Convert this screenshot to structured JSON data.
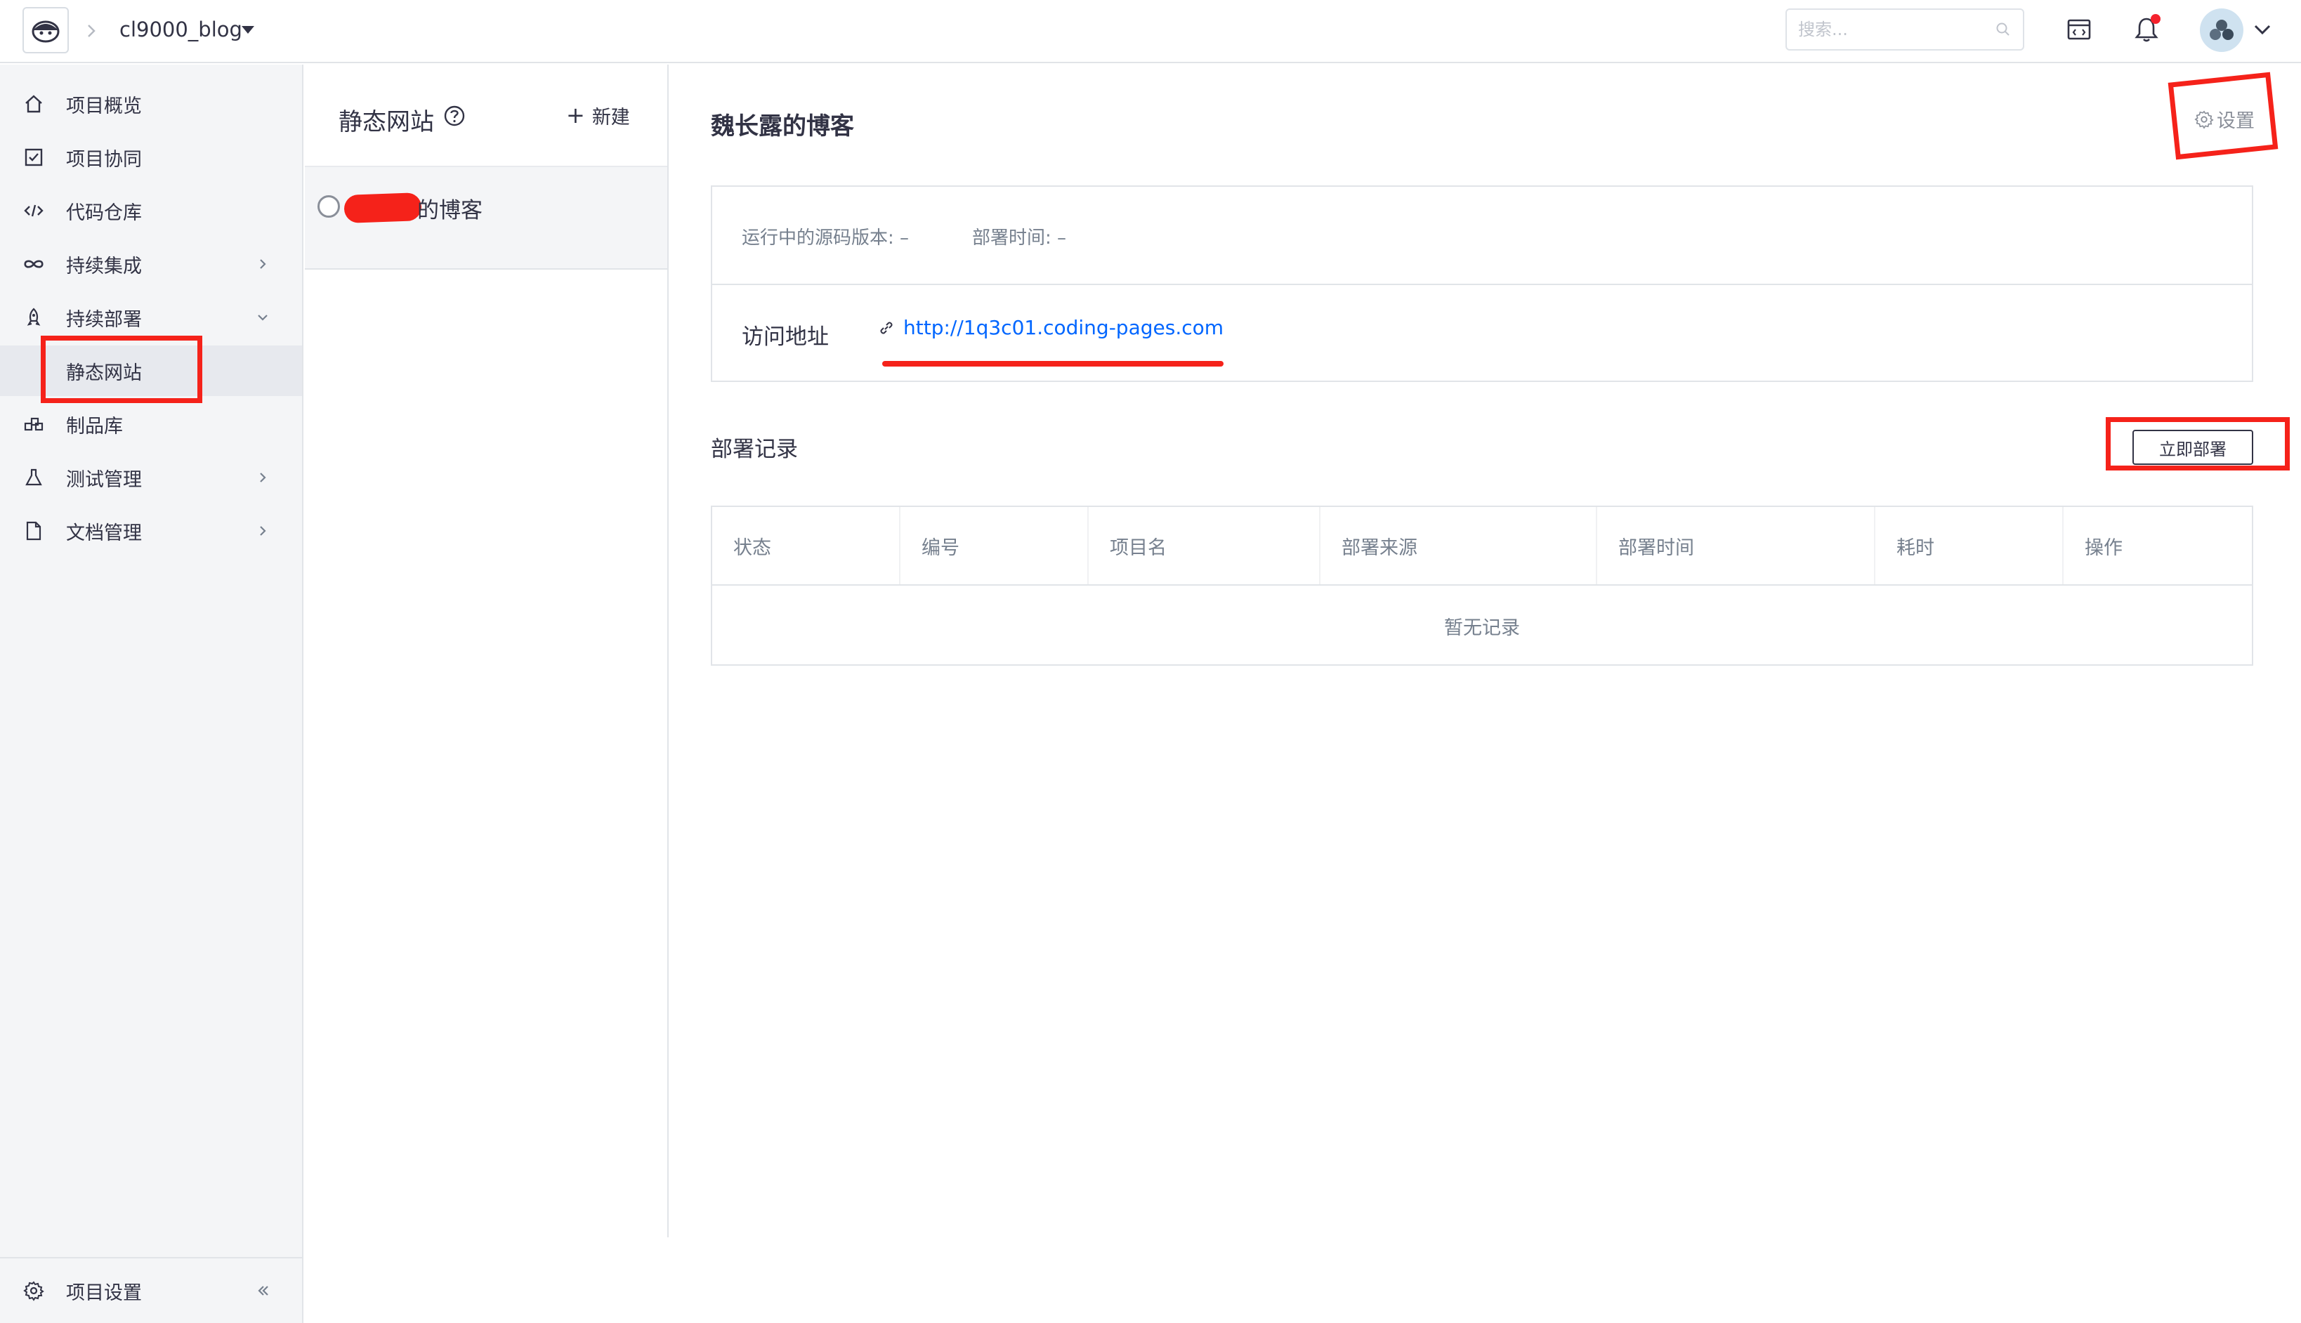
{
  "topbar": {
    "project_name": "cl9000_blog",
    "search_placeholder": "搜索..."
  },
  "nav": {
    "items": [
      {
        "label": "项目概览",
        "icon": "home-icon"
      },
      {
        "label": "项目协同",
        "icon": "checkbox-icon"
      },
      {
        "label": "代码仓库",
        "icon": "code-icon"
      },
      {
        "label": "持续集成",
        "icon": "infinity-icon"
      },
      {
        "label": "持续部署",
        "icon": "rocket-icon"
      },
      {
        "label": "静态网站",
        "icon": ""
      },
      {
        "label": "制品库",
        "icon": "package-icon"
      },
      {
        "label": "测试管理",
        "icon": "flask-icon"
      },
      {
        "label": "文档管理",
        "icon": "file-icon"
      }
    ],
    "bottom_label": "项目设置"
  },
  "sites": {
    "title": "静态网站",
    "new_label": "新建",
    "items": [
      {
        "name": "的博客"
      }
    ]
  },
  "main": {
    "title": "魏长露的博客",
    "settings_label": "设置",
    "info": {
      "version_label": "运行中的源码版本:",
      "version_value": "–",
      "time_label": "部署时间:",
      "time_value": "–",
      "address_label": "访问地址",
      "address_url": "http://1q3c01.coding-pages.com"
    },
    "records": {
      "title": "部署记录",
      "deploy_button": "立即部署",
      "columns": [
        "状态",
        "编号",
        "项目名",
        "部署来源",
        "部署时间",
        "耗时",
        "操作"
      ],
      "empty_text": "暂无记录"
    }
  },
  "colors": {
    "accent": "#0066ff",
    "annotation_red": "#f5221a",
    "notification_dot": "#f5222d"
  }
}
